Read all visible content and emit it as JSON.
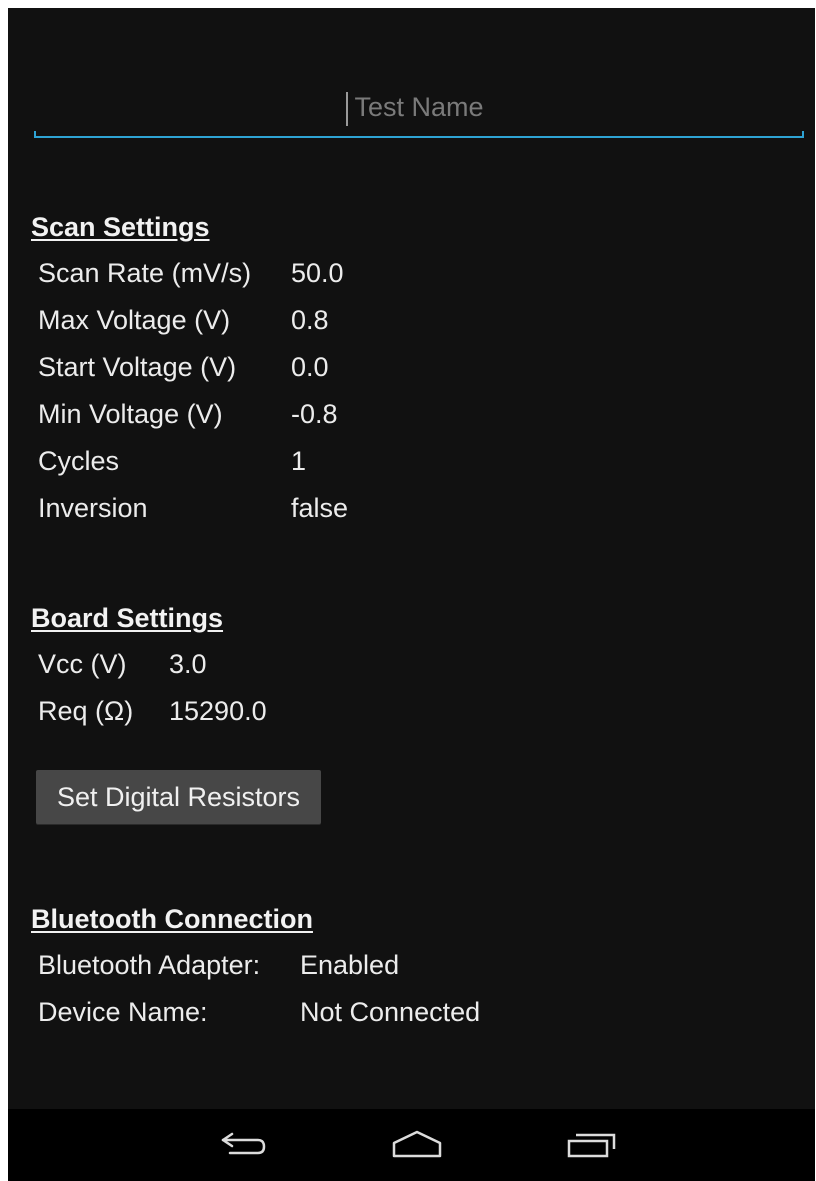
{
  "test_name": {
    "placeholder": "Test Name",
    "value": ""
  },
  "scan_settings": {
    "title": "Scan Settings",
    "rows": [
      {
        "label": "Scan Rate (mV/s)",
        "value": "50.0"
      },
      {
        "label": "Max Voltage (V)",
        "value": "0.8"
      },
      {
        "label": "Start Voltage (V)",
        "value": "0.0"
      },
      {
        "label": "Min Voltage (V)",
        "value": "-0.8"
      },
      {
        "label": "Cycles",
        "value": "1"
      },
      {
        "label": "Inversion",
        "value": "false"
      }
    ]
  },
  "board_settings": {
    "title": "Board Settings",
    "rows": [
      {
        "label": "Vcc (V)",
        "value": "3.0"
      },
      {
        "label": "Req (Ω)",
        "value": "15290.0"
      }
    ],
    "button_label": "Set Digital Resistors"
  },
  "bluetooth": {
    "title": "Bluetooth Connection",
    "rows": [
      {
        "label": "Bluetooth Adapter:",
        "value": "Enabled"
      },
      {
        "label": "Device Name:",
        "value": "Not Connected"
      }
    ]
  },
  "navbar": {
    "back_icon": "back-icon",
    "home_icon": "home-icon",
    "recents_icon": "recents-icon"
  },
  "colors": {
    "background": "#111111",
    "accent": "#2ea3d4",
    "button": "#474747",
    "navbar": "#000000"
  }
}
